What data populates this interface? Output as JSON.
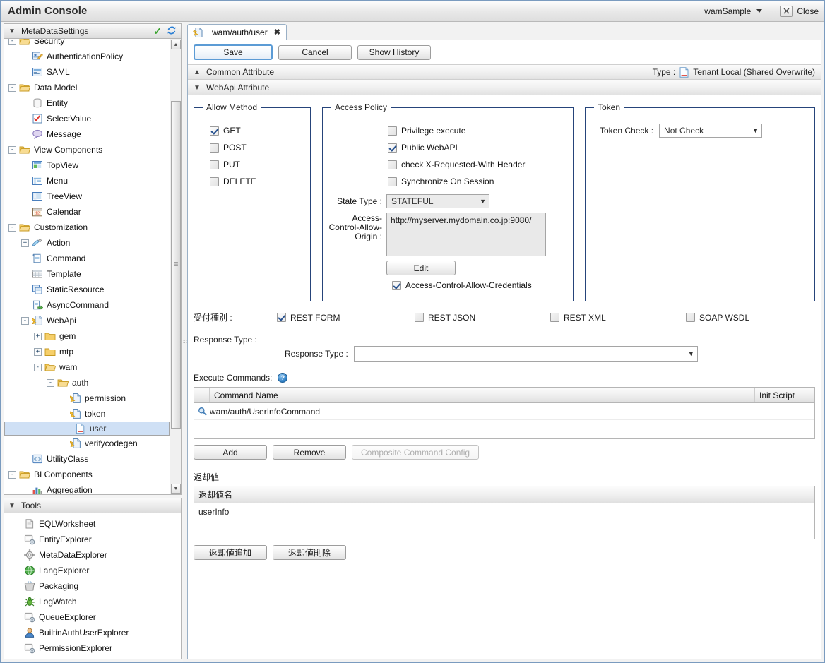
{
  "window": {
    "title": "Admin Console",
    "tenant": "wamSample",
    "close_label": "Close",
    "close_icon": "x-icon"
  },
  "sidebar": {
    "metadata_header": {
      "label": "MetaDataSettings",
      "chevron": "chevron-down-icon",
      "check_icon": "green-check-icon",
      "refresh_icon": "refresh-icon"
    },
    "tree": [
      {
        "label": "Security",
        "depth": 1,
        "expander": "-",
        "icon": "folder-open-icon",
        "selected": false,
        "clipped": true
      },
      {
        "label": "AuthenticationPolicy",
        "depth": 2,
        "expander": "",
        "icon": "policy-icon",
        "selected": false
      },
      {
        "label": "SAML",
        "depth": 2,
        "expander": "",
        "icon": "saml-icon",
        "selected": false
      },
      {
        "label": "Data Model",
        "depth": 1,
        "expander": "-",
        "icon": "folder-open-icon",
        "selected": false
      },
      {
        "label": "Entity",
        "depth": 2,
        "expander": "",
        "icon": "entity-icon",
        "selected": false
      },
      {
        "label": "SelectValue",
        "depth": 2,
        "expander": "",
        "icon": "selectvalue-icon",
        "selected": false
      },
      {
        "label": "Message",
        "depth": 2,
        "expander": "",
        "icon": "message-icon",
        "selected": false
      },
      {
        "label": "View Components",
        "depth": 1,
        "expander": "-",
        "icon": "folder-open-icon",
        "selected": false
      },
      {
        "label": "TopView",
        "depth": 2,
        "expander": "",
        "icon": "topview-icon",
        "selected": false
      },
      {
        "label": "Menu",
        "depth": 2,
        "expander": "",
        "icon": "menu-icon",
        "selected": false
      },
      {
        "label": "TreeView",
        "depth": 2,
        "expander": "",
        "icon": "treeview-icon",
        "selected": false
      },
      {
        "label": "Calendar",
        "depth": 2,
        "expander": "",
        "icon": "calendar-icon",
        "selected": false
      },
      {
        "label": "Customization",
        "depth": 1,
        "expander": "-",
        "icon": "folder-open-icon",
        "selected": false
      },
      {
        "label": "Action",
        "depth": 2,
        "expander": "+",
        "icon": "action-icon",
        "selected": false
      },
      {
        "label": "Command",
        "depth": 2,
        "expander": "",
        "icon": "command-icon",
        "selected": false
      },
      {
        "label": "Template",
        "depth": 2,
        "expander": "",
        "icon": "template-icon",
        "selected": false
      },
      {
        "label": "StaticResource",
        "depth": 2,
        "expander": "",
        "icon": "staticresource-icon",
        "selected": false
      },
      {
        "label": "AsyncCommand",
        "depth": 2,
        "expander": "",
        "icon": "asynccommand-icon",
        "selected": false
      },
      {
        "label": "WebApi",
        "depth": 2,
        "expander": "-",
        "icon": "webapi-icon",
        "selected": false
      },
      {
        "label": "gem",
        "depth": 3,
        "expander": "+",
        "icon": "folder-icon",
        "selected": false
      },
      {
        "label": "mtp",
        "depth": 3,
        "expander": "+",
        "icon": "folder-icon",
        "selected": false
      },
      {
        "label": "wam",
        "depth": 3,
        "expander": "-",
        "icon": "folder-open-icon",
        "selected": false
      },
      {
        "label": "auth",
        "depth": 4,
        "expander": "-",
        "icon": "folder-open-icon",
        "selected": false
      },
      {
        "label": "permission",
        "depth": 5,
        "expander": "",
        "icon": "webapi-file-icon",
        "selected": false
      },
      {
        "label": "token",
        "depth": 5,
        "expander": "",
        "icon": "webapi-file-icon",
        "selected": false
      },
      {
        "label": "user",
        "depth": 5,
        "expander": "",
        "icon": "doc-icon",
        "selected": true
      },
      {
        "label": "verifycodegen",
        "depth": 5,
        "expander": "",
        "icon": "webapi-file-icon",
        "selected": false
      },
      {
        "label": "UtilityClass",
        "depth": 2,
        "expander": "",
        "icon": "utilityclass-icon",
        "selected": false
      },
      {
        "label": "BI Components",
        "depth": 1,
        "expander": "-",
        "icon": "folder-open-icon",
        "selected": false
      },
      {
        "label": "Aggregation",
        "depth": 2,
        "expander": "",
        "icon": "aggregation-icon",
        "selected": false,
        "clipped": true
      }
    ],
    "tools_header": {
      "label": "Tools",
      "chevron": "chevron-down-icon"
    },
    "tools": [
      {
        "label": "EQLWorksheet",
        "icon": "eql-icon"
      },
      {
        "label": "EntityExplorer",
        "icon": "entity-explorer-icon"
      },
      {
        "label": "MetaDataExplorer",
        "icon": "gear-icon"
      },
      {
        "label": "LangExplorer",
        "icon": "globe-icon"
      },
      {
        "label": "Packaging",
        "icon": "package-icon"
      },
      {
        "label": "LogWatch",
        "icon": "bug-icon"
      },
      {
        "label": "QueueExplorer",
        "icon": "queue-icon"
      },
      {
        "label": "BuiltinAuthUserExplorer",
        "icon": "user-icon"
      },
      {
        "label": "PermissionExplorer",
        "icon": "permission-explorer-icon"
      }
    ]
  },
  "editor": {
    "tab": {
      "label": "wam/auth/user",
      "icon": "webapi-file-icon",
      "close_icon": "x-icon"
    },
    "toolbar": {
      "save_label": "Save",
      "cancel_label": "Cancel",
      "history_label": "Show History"
    },
    "common_attribute": {
      "label": "Common Attribute",
      "chevron": "chevron-up-icon",
      "type_label": "Type :",
      "type_value": "Tenant Local (Shared Overwrite)",
      "type_icon": "doc-icon"
    },
    "webapi_attribute": {
      "label": "WebApi Attribute",
      "chevron": "chevron-down-icon"
    },
    "allow_method": {
      "legend": "Allow Method",
      "items": [
        {
          "label": "GET",
          "checked": true
        },
        {
          "label": "POST",
          "checked": false
        },
        {
          "label": "PUT",
          "checked": false
        },
        {
          "label": "DELETE",
          "checked": false
        }
      ]
    },
    "access_policy": {
      "legend": "Access Policy",
      "items": [
        {
          "label": "Privilege execute",
          "checked": false
        },
        {
          "label": "Public WebAPI",
          "checked": true
        },
        {
          "label": "check X-Requested-With Header",
          "checked": false
        },
        {
          "label": "Synchronize On Session",
          "checked": false
        }
      ],
      "state_type_label": "State Type :",
      "state_type_value": "STATEFUL",
      "origin_label": "Access-Control-Allow-Origin :",
      "origin_value": "http://myserver.mydomain.co.jp:9080/",
      "edit_label": "Edit",
      "credentials_label": "Access-Control-Allow-Credentials",
      "credentials_checked": true
    },
    "token": {
      "legend": "Token",
      "check_label": "Token Check :",
      "check_value": "Not Check"
    },
    "accept_type": {
      "label": "受付種別 :",
      "items": [
        {
          "label": "REST FORM",
          "checked": true
        },
        {
          "label": "REST JSON",
          "checked": false
        },
        {
          "label": "REST XML",
          "checked": false
        },
        {
          "label": "SOAP WSDL",
          "checked": false
        }
      ]
    },
    "response_type": {
      "outer_label": "Response Type :",
      "inner_label": "Response Type :",
      "value": ""
    },
    "execute_commands": {
      "label": "Execute Commands:",
      "help_icon": "help-icon",
      "columns": [
        "Command Name",
        "Init Script"
      ],
      "rows": [
        {
          "search_icon": "magnifier-icon",
          "command_name": "wam/auth/UserInfoCommand",
          "init_script": ""
        }
      ],
      "buttons": {
        "add": "Add",
        "remove": "Remove",
        "composite": "Composite Command Config"
      }
    },
    "return_values": {
      "title": "返却値",
      "column": "返却値名",
      "rows": [
        "userInfo"
      ],
      "buttons": {
        "add": "返却値追加",
        "remove": "返却値削除"
      }
    }
  },
  "colors": {
    "accent": "#26447a",
    "selection": "#cfe0f5",
    "primary_border": "#5b9bd5",
    "check_green": "#37a22b"
  }
}
